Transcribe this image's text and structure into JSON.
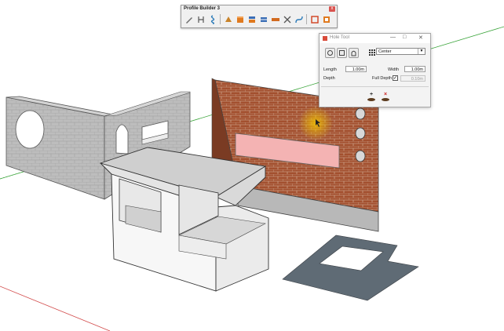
{
  "toolbar": {
    "title": "Profile Builder 3",
    "close_glyph": "x",
    "buttons": [
      {
        "icon": "pencil-icon",
        "color": "#6b6b6b"
      },
      {
        "icon": "measure-icon",
        "color": "#555555"
      },
      {
        "icon": "swirl-icon",
        "color": "#2a7ab8"
      },
      {
        "icon": "paint-icon",
        "color": "#c8832a"
      },
      {
        "icon": "box-icon",
        "color": "#e07a1f"
      },
      {
        "icon": "stack-icon",
        "color": "#3a6db5"
      },
      {
        "icon": "shelf-icon",
        "color": "#3a6db5"
      },
      {
        "icon": "tape-icon",
        "color": "#d26a1f"
      },
      {
        "icon": "scissors-icon",
        "color": "#555555"
      },
      {
        "icon": "curve-icon",
        "color": "#2a7ab8"
      },
      {
        "icon": "frame-icon",
        "color": "#d24a2a"
      },
      {
        "icon": "window-icon",
        "color": "#e07a1f"
      }
    ]
  },
  "dialog": {
    "title": "Hole Tool",
    "align": {
      "selected": "Center"
    },
    "length": {
      "label": "Length",
      "value": "1.00m"
    },
    "width": {
      "label": "Width",
      "value": "1.00m"
    },
    "depth": {
      "label": "Depth"
    },
    "full_depth": {
      "label": "Full Depth",
      "checked": true,
      "value": "0.10m"
    },
    "add_glyph": "+",
    "remove_glyph": "×"
  },
  "colors": {
    "brick": "#a3502f",
    "stone": "#bdbdbd",
    "slab": "#f7f7f7",
    "floor_plate": "#5f6b75",
    "axis_red": "#d24a4a",
    "axis_green": "#3aa43a",
    "cursor_halo": "#f2c300"
  }
}
